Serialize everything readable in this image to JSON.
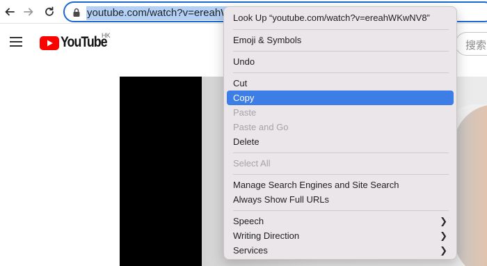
{
  "browser": {
    "url": "youtube.com/watch?v=ereahWKwNV8",
    "url_visible": "youtube.com/watch?v=ereahWK"
  },
  "youtube": {
    "logo_text": "YouTube",
    "region": "HK",
    "search_placeholder": "搜索",
    "brand_color": "#ff0000"
  },
  "context_menu": {
    "items": [
      {
        "label": "Look Up “youtube.com/watch?v=ereahWKwNV8”",
        "state": "enabled"
      },
      {
        "label": "Emoji & Symbols",
        "state": "enabled"
      },
      {
        "label": "Undo",
        "state": "enabled"
      },
      {
        "label": "Cut",
        "state": "enabled"
      },
      {
        "label": "Copy",
        "state": "selected"
      },
      {
        "label": "Paste",
        "state": "disabled"
      },
      {
        "label": "Paste and Go",
        "state": "disabled"
      },
      {
        "label": "Delete",
        "state": "enabled"
      },
      {
        "label": "Select All",
        "state": "disabled"
      },
      {
        "label": "Manage Search Engines and Site Search",
        "state": "enabled"
      },
      {
        "label": "Always Show Full URLs",
        "state": "enabled"
      },
      {
        "label": "Speech",
        "state": "enabled",
        "submenu": true
      },
      {
        "label": "Writing Direction",
        "state": "enabled",
        "submenu": true
      },
      {
        "label": "Services",
        "state": "enabled",
        "submenu": true
      }
    ],
    "highlight_color": "#3d7ee6"
  }
}
